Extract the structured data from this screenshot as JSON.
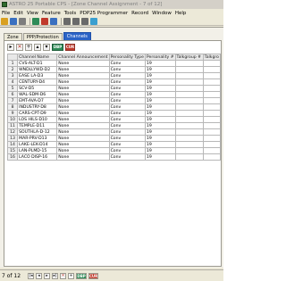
{
  "window": {
    "title": "ASTRO 25 Portable CPS - [Zone Channel Assignment - 7 of 12]"
  },
  "menu": {
    "items": [
      "File",
      "Edit",
      "View",
      "Feature",
      "Tools",
      "PDP25 Programmer",
      "Record",
      "Window",
      "Help"
    ]
  },
  "tabs": [
    {
      "label": "Zone",
      "active": false
    },
    {
      "label": "PPP/Protection",
      "active": false
    },
    {
      "label": "Channels",
      "active": true
    }
  ],
  "grid_toolbar": {
    "dbp_label": "DBP",
    "cur_label": "CUR"
  },
  "table": {
    "headers": [
      "",
      "Channel Name",
      "Channel Announcement",
      "Personality Type",
      "Personality #",
      "Talkgroup #",
      "Talkgro"
    ],
    "rows": [
      {
        "num": "1",
        "name": "CVS-ALT-D1",
        "announcement": "None",
        "type": "Conv",
        "personality": "19"
      },
      {
        "num": "2",
        "name": "WNDLLYWD-D2",
        "announcement": "None",
        "type": "Conv",
        "personality": "19"
      },
      {
        "num": "3",
        "name": "EASE LA-D3",
        "announcement": "None",
        "type": "Conv",
        "personality": "19"
      },
      {
        "num": "4",
        "name": "CENTURY-D4",
        "announcement": "None",
        "type": "Conv",
        "personality": "19"
      },
      {
        "num": "5",
        "name": "SCV-D5",
        "announcement": "None",
        "type": "Conv",
        "personality": "19"
      },
      {
        "num": "6",
        "name": "WAL-SDM-D6",
        "announcement": "None",
        "type": "Conv",
        "personality": "19"
      },
      {
        "num": "7",
        "name": "EMT-AVA-D7",
        "announcement": "None",
        "type": "Conv",
        "personality": "19"
      },
      {
        "num": "8",
        "name": "INDUSTRY-D8",
        "announcement": "None",
        "type": "Conv",
        "personality": "19"
      },
      {
        "num": "9",
        "name": "CARS-CPT-D9",
        "announcement": "None",
        "type": "Conv",
        "personality": "19"
      },
      {
        "num": "10",
        "name": "LOS HILS-D10",
        "announcement": "None",
        "type": "Conv",
        "personality": "19"
      },
      {
        "num": "11",
        "name": "TEMPLE-D11",
        "announcement": "None",
        "type": "Conv",
        "personality": "19"
      },
      {
        "num": "12",
        "name": "SOUTHLA-D-12",
        "announcement": "None",
        "type": "Conv",
        "personality": "19"
      },
      {
        "num": "13",
        "name": "MAR-PRV-D13",
        "announcement": "None",
        "type": "Conv",
        "personality": "19"
      },
      {
        "num": "14",
        "name": "LAKE-LEK-D14",
        "announcement": "None",
        "type": "Conv",
        "personality": "19"
      },
      {
        "num": "15",
        "name": "LAN-PLMD-15",
        "announcement": "None",
        "type": "Conv",
        "personality": "19"
      },
      {
        "num": "16",
        "name": "LACO DISP-16",
        "announcement": "None",
        "type": "Conv",
        "personality": "19"
      }
    ]
  },
  "status": {
    "page_text": "7 of 12",
    "dbp_label": "DBP",
    "cur_label": "CUR"
  },
  "colors": {
    "active_tab": "#2b63c6",
    "dbp": "#2e8b57",
    "cur": "#c0392b"
  }
}
